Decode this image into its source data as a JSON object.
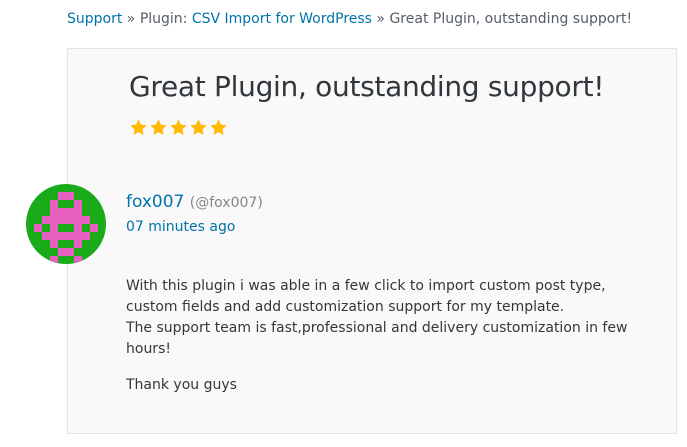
{
  "breadcrumb": {
    "support": "Support",
    "sep1": " » ",
    "plugin_prefix": "Plugin: ",
    "plugin_name": "CSV Import for WordPress",
    "sep2": " » ",
    "current": "Great Plugin, outstanding support!"
  },
  "review": {
    "title": "Great Plugin, outstanding support!",
    "rating": 5,
    "rating_max": 5,
    "star_color": "#ffb900"
  },
  "author": {
    "name": "fox007",
    "handle": "(@fox007)",
    "timestamp": "07 minutes ago",
    "avatar_colors": [
      "#1aab1a",
      "#e85fbf"
    ]
  },
  "content": {
    "line1": "With this plugin i was able in a few click to import custom post type, custom fields and add customization support for my template.",
    "line2": "The support team is fast,professional and delivery customization in few hours!",
    "line3": "Thank you guys"
  }
}
